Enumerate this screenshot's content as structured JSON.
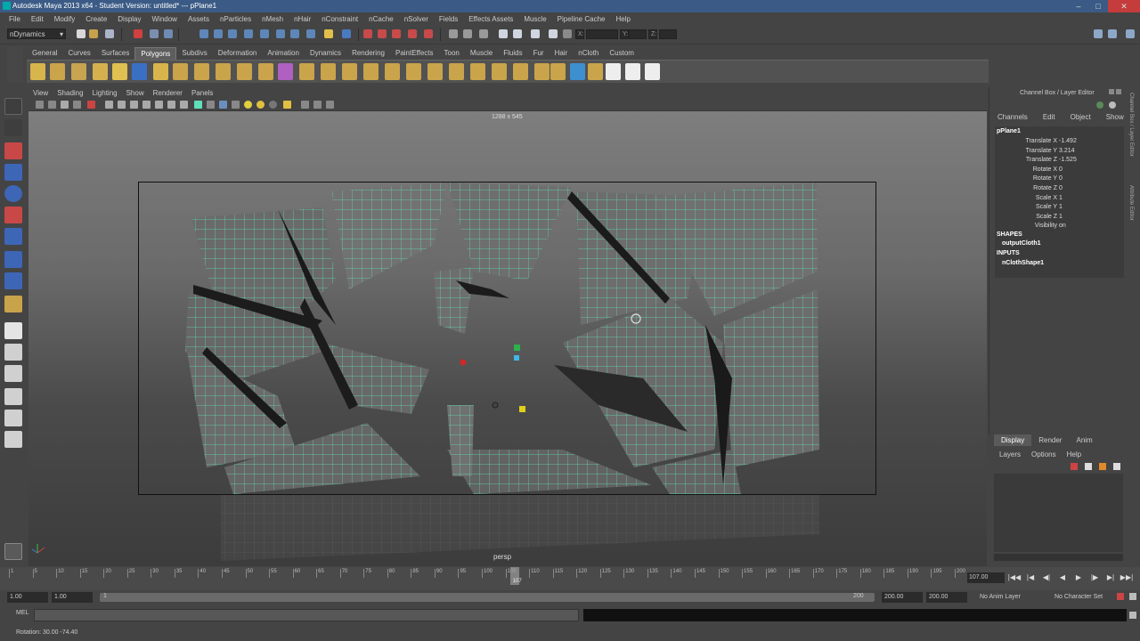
{
  "window": {
    "title": "Autodesk Maya 2013 x64 - Student Version: untitled*   ---   pPlane1"
  },
  "menu": [
    "File",
    "Edit",
    "Modify",
    "Create",
    "Display",
    "Window",
    "Assets",
    "nParticles",
    "nMesh",
    "nHair",
    "nConstraint",
    "nCache",
    "nSolver",
    "Fields",
    "Effects Assets",
    "Muscle",
    "Pipeline Cache",
    "Help"
  ],
  "status": {
    "mode": "nDynamics",
    "x_label": "X:",
    "y_label": "Y:",
    "z_label": "Z:"
  },
  "shelf_tabs": [
    "General",
    "Curves",
    "Surfaces",
    "Polygons",
    "Subdivs",
    "Deformation",
    "Animation",
    "Dynamics",
    "Rendering",
    "PaintEffects",
    "Toon",
    "Muscle",
    "Fluids",
    "Fur",
    "Hair",
    "nCloth",
    "Custom"
  ],
  "shelf_active": "Polygons",
  "viewport_menu": [
    "View",
    "Shading",
    "Lighting",
    "Show",
    "Renderer",
    "Panels"
  ],
  "viewport": {
    "resolution": "1288 x 545",
    "camera": "persp"
  },
  "channel_box": {
    "title": "Channel Box / Layer Editor",
    "menu": [
      "Channels",
      "Edit",
      "Object",
      "Show"
    ],
    "object": "pPlane1",
    "attributes": [
      {
        "name": "Translate X",
        "value": "-1.492"
      },
      {
        "name": "Translate Y",
        "value": "3.214"
      },
      {
        "name": "Translate Z",
        "value": "-1.525"
      },
      {
        "name": "Rotate X",
        "value": "0"
      },
      {
        "name": "Rotate Y",
        "value": "0"
      },
      {
        "name": "Rotate Z",
        "value": "0"
      },
      {
        "name": "Scale X",
        "value": "1"
      },
      {
        "name": "Scale Y",
        "value": "1"
      },
      {
        "name": "Scale Z",
        "value": "1"
      },
      {
        "name": "Visibility",
        "value": "on"
      }
    ],
    "shapes_header": "SHAPES",
    "shapes": [
      "outputCloth1"
    ],
    "inputs_header": "INPUTS",
    "inputs": [
      "nClothShape1"
    ],
    "side_tabs": [
      "Channel Box / Layer Editor",
      "Attribute Editor"
    ]
  },
  "layer_editor": {
    "tabs": [
      "Display",
      "Render",
      "Anim"
    ],
    "active": "Display",
    "menu": [
      "Layers",
      "Options",
      "Help"
    ]
  },
  "time_slider": {
    "ticks": [
      "1",
      "5",
      "10",
      "15",
      "20",
      "25",
      "30",
      "35",
      "40",
      "45",
      "50",
      "55",
      "60",
      "65",
      "70",
      "75",
      "80",
      "85",
      "90",
      "95",
      "100",
      "105",
      "110",
      "115",
      "120",
      "125",
      "130",
      "135",
      "140",
      "145",
      "150",
      "155",
      "160",
      "165",
      "170",
      "175",
      "180",
      "185",
      "190",
      "195",
      "200"
    ],
    "current": 107,
    "current_label": "107",
    "end_field": "107.00"
  },
  "range": {
    "start": "1.00",
    "start2": "1.00",
    "frame": "1",
    "end_label": "200",
    "end": "200.00",
    "end2": "200.00",
    "anim_layer": "No Anim Layer",
    "char_set": "No Character Set"
  },
  "command": {
    "label": "MEL"
  },
  "help": {
    "text": "Rotation:   30.00    -74.40"
  },
  "colors": {
    "wire": "#5fe0b8",
    "title_bar": "#3b5b86"
  }
}
